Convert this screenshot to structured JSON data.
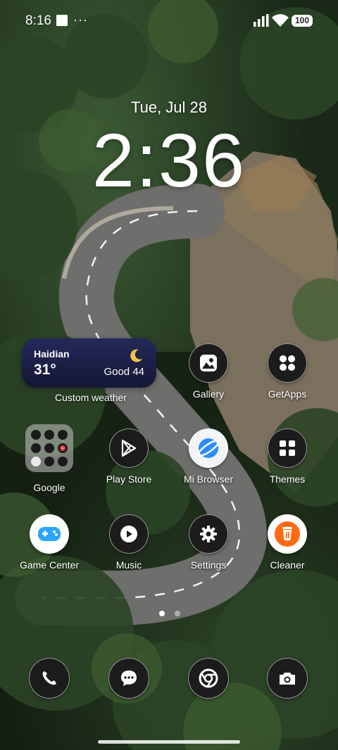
{
  "status_bar": {
    "time": "8:16",
    "overflow": "···",
    "battery": "100"
  },
  "lockclock": {
    "date": "Tue, Jul 28",
    "time": "2:36"
  },
  "weather_widget": {
    "city": "Haidian",
    "temperature": "31°",
    "air_quality": "Good 44",
    "label": "Custom weather",
    "condition_icon": "moon-icon"
  },
  "apps": {
    "gallery": "Gallery",
    "getapps": "GetApps",
    "google": "Google",
    "playstore": "Play Store",
    "browser": "Mi Browser",
    "themes": "Themes",
    "gamecenter": "Game Center",
    "music": "Music",
    "settings": "Settings",
    "cleaner": "Cleaner"
  },
  "dock": [
    "phone-icon",
    "messages-icon",
    "chrome-icon",
    "camera-icon"
  ],
  "colors": {
    "browser_blue": "#2f8cff",
    "cleaner_orange": "#ff6a13",
    "gamecenter_blue": "#2aa6ff"
  }
}
